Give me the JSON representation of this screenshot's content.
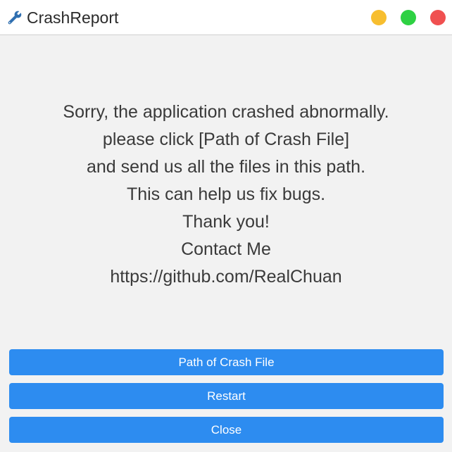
{
  "window": {
    "title": "CrashReport",
    "icon": "wrench-icon",
    "controls": {
      "minimize_color": "#f7be2f",
      "maximize_color": "#2ed143",
      "close_color": "#f05050"
    }
  },
  "message": {
    "lines": [
      "Sorry, the application crashed abnormally.",
      "please click [Path of Crash File]",
      "and send us all the files in this path.",
      "This can help us fix bugs.",
      "Thank you!",
      "Contact Me",
      "https://github.com/RealChuan"
    ]
  },
  "buttons": {
    "path_label": "Path of Crash File",
    "restart_label": "Restart",
    "close_label": "Close",
    "color": "#2d8cf0"
  }
}
